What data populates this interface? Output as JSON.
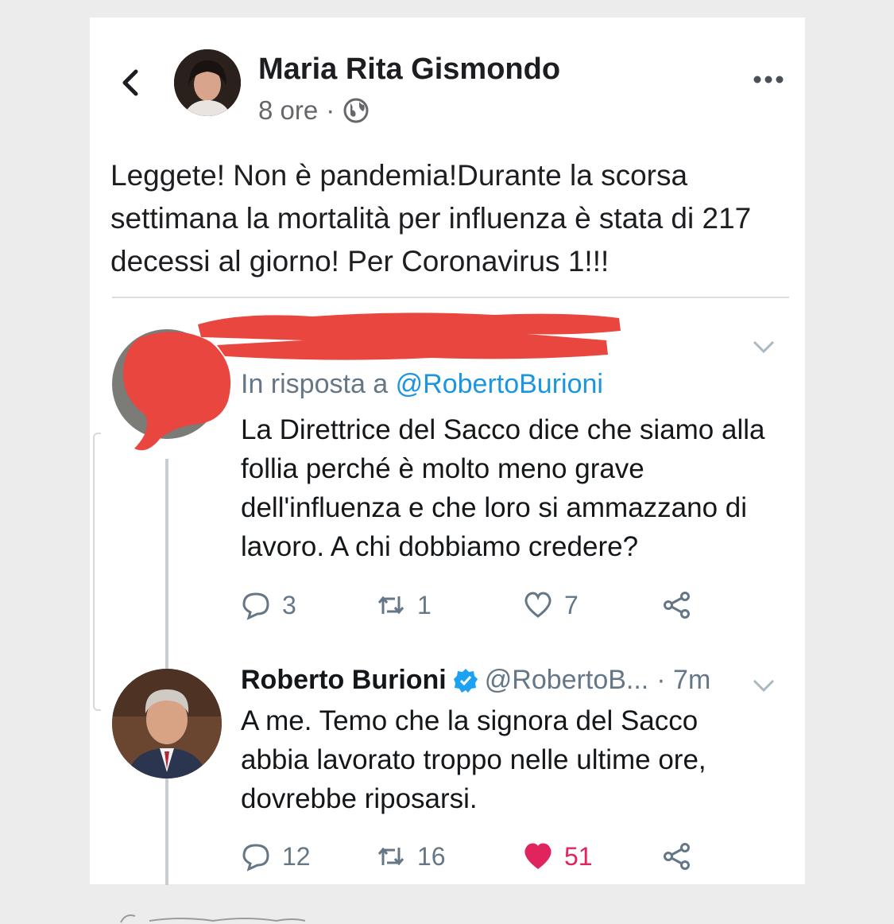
{
  "post": {
    "author": "Maria Rita Gismondo",
    "time": "8 ore",
    "separator": "·",
    "text": "Leggete! Non è pandemia!Durante la scorsa settimana la mortalità per influenza è stata  di 217 decessi al giorno! Per Coronavirus 1!!!"
  },
  "tweet1": {
    "reply_prefix": "In risposta a ",
    "reply_handle": "@RobertoBurioni",
    "text": "La Direttrice del Sacco dice che siamo alla follia perché è molto meno grave dell'influenza e che loro si ammazzano di lavoro. A chi dobbiamo credere?",
    "replies": "3",
    "retweets": "1",
    "likes": "7"
  },
  "tweet2": {
    "author": "Roberto Burioni",
    "handle": "@RobertoB...",
    "time": "· 7m",
    "text": "A me. Temo che la signora del Sacco abbia lavorato troppo nelle ultime ore, dovrebbe riposarsi.",
    "replies": "12",
    "retweets": "16",
    "likes": "51"
  },
  "colors": {
    "accent_blue": "#1b95e0",
    "like_red": "#e0245e",
    "redaction": "#e8463f"
  },
  "icons": [
    "back-arrow-icon",
    "globe-icon",
    "more-options-icon",
    "chevron-down-icon",
    "reply-icon",
    "retweet-icon",
    "like-icon",
    "share-icon",
    "verified-badge-icon"
  ]
}
